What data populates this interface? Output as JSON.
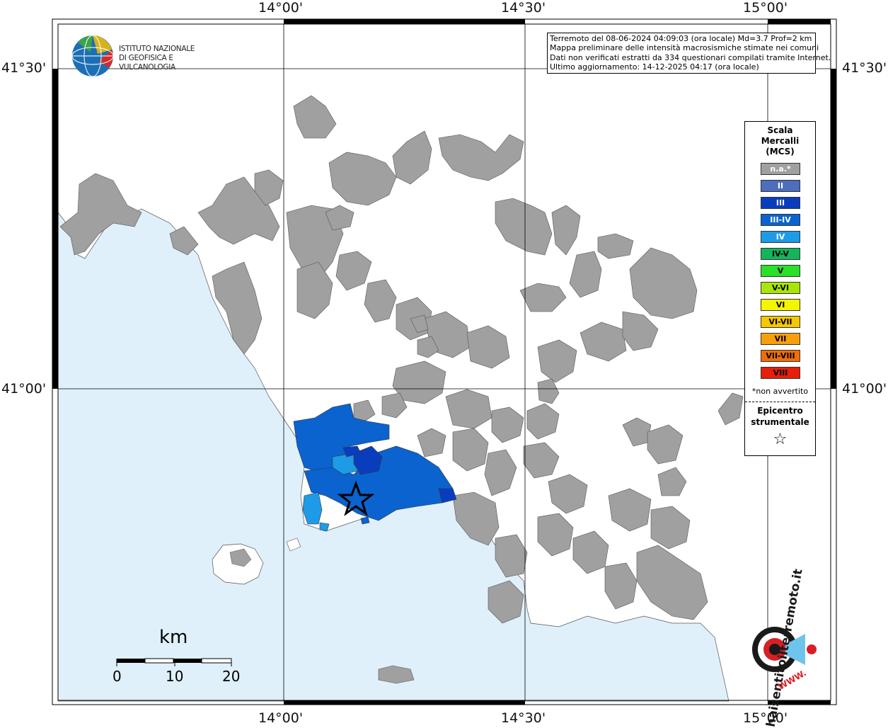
{
  "map": {
    "longitude_labels": [
      "14°00'",
      "14°30'",
      "15°00'"
    ],
    "latitude_labels": [
      "41°30'",
      "41°00'"
    ],
    "colors": {
      "sea": "#dff0fb",
      "land": "#ffffff",
      "not_felt": "#a0a0a0",
      "intensity_II": "#4d6dbd",
      "intensity_III": "#0a3dbd",
      "intensity_III_IV": "#0a63cf",
      "intensity_IV": "#1e9be6"
    }
  },
  "logo": {
    "name": "ISTITUTO NAZIONALE",
    "name_line2": "DI GEOFISICA E VULCANOLOGIA"
  },
  "info": {
    "line1": "Terremoto del 08-06-2024 04:09:03 (ora locale) Md=3.7 Prof=2 km",
    "line2": "Mappa preliminare delle intensità macrosismiche stimate nei comuni",
    "line3": "Dati non verificati estratti da 334 questionari compilati tramite Internet.",
    "line4": "Ultimo aggiornamento: 14-12-2025 04:17 (ora locale)"
  },
  "legend": {
    "title1": "Scala",
    "title2": "Mercalli",
    "title3": "(MCS)",
    "items": [
      {
        "label": "n.a.*",
        "color": "#a0a0a0"
      },
      {
        "label": "II",
        "color": "#4d6dbd"
      },
      {
        "label": "III",
        "color": "#0a3dbd"
      },
      {
        "label": "III-IV",
        "color": "#0a63cf"
      },
      {
        "label": "IV",
        "color": "#1e9be6"
      },
      {
        "label": "IV-V",
        "color": "#14b45a"
      },
      {
        "label": "V",
        "color": "#28e128"
      },
      {
        "label": "V-VI",
        "color": "#a8e60a"
      },
      {
        "label": "VI",
        "color": "#f5f500"
      },
      {
        "label": "VI-VII",
        "color": "#f5c800"
      },
      {
        "label": "VII",
        "color": "#f5a00a"
      },
      {
        "label": "VII-VIII",
        "color": "#f06e0a"
      },
      {
        "label": "VIII",
        "color": "#e61e0a"
      }
    ],
    "note": "*non avvertito",
    "epicenter1": "Epicentro",
    "epicenter2": "strumentale",
    "star": "☆"
  },
  "scalebar": {
    "unit": "km",
    "labels": [
      "0",
      "10",
      "20"
    ]
  },
  "brand": {
    "text": "haisentitoilterremoto.it",
    "url": "WWW."
  }
}
